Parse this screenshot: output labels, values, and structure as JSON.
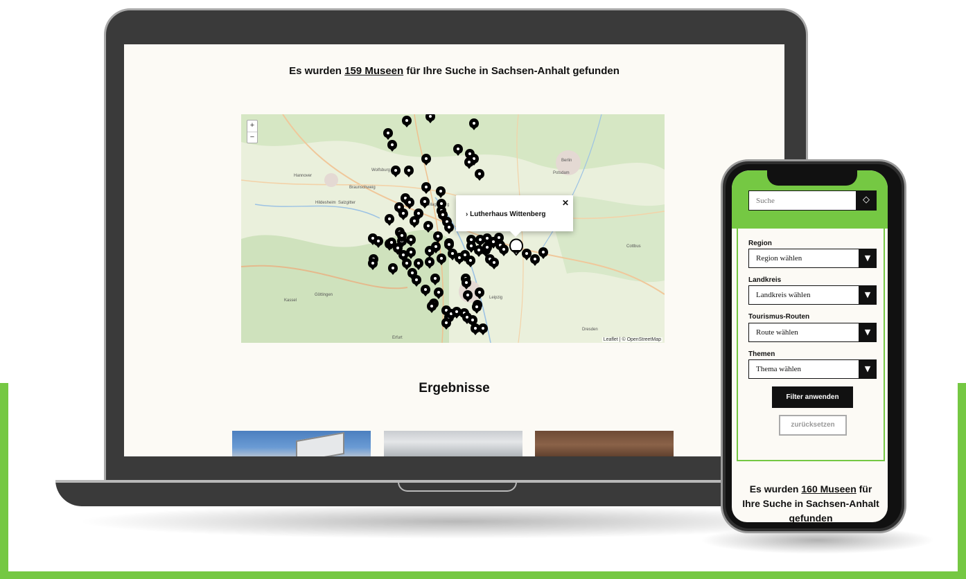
{
  "desktop": {
    "heading_prefix": "Es wurden",
    "heading_count": "159 Museen",
    "heading_suffix": "für Ihre Suche in Sachsen-Anhalt gefunden",
    "map": {
      "zoom_in": "+",
      "zoom_out": "−",
      "popup_title": "Lutherhaus Wittenberg",
      "popup_chevron": "›",
      "popup_close": "✕",
      "attribution": "Leaflet | © OpenStreetMap",
      "place_labels": [
        "Hannover",
        "Wolfsburg",
        "Braunschweig",
        "Salzgitter",
        "Hildesheim",
        "Magdeburg",
        "Berlin",
        "Potsdam",
        "Göttingen",
        "Kassel",
        "Leipzig",
        "Dresden",
        "Erfurt",
        "Cottbus"
      ],
      "marker_icon": "map-pin-icon"
    },
    "results_heading": "Ergebnisse"
  },
  "mobile": {
    "search_placeholder": "Suche",
    "search_icon": "search-icon",
    "filters": [
      {
        "label": "Region",
        "value": "Region wählen"
      },
      {
        "label": "Landkreis",
        "value": "Landkreis wählen"
      },
      {
        "label": "Tourismus-Routen",
        "value": "Route wählen"
      },
      {
        "label": "Themen",
        "value": "Thema wählen"
      }
    ],
    "apply_label": "Filter anwenden",
    "reset_label": "zurücksetzen",
    "heading_prefix": "Es wurden",
    "heading_count": "160 Museen",
    "heading_suffix": "für Ihre Suche in Sachsen-Anhalt gefunden"
  },
  "colors": {
    "accent_green": "#75c843",
    "background": "#fcfaf5",
    "device_frame": "#3a3a3a",
    "marker": "#000000"
  }
}
